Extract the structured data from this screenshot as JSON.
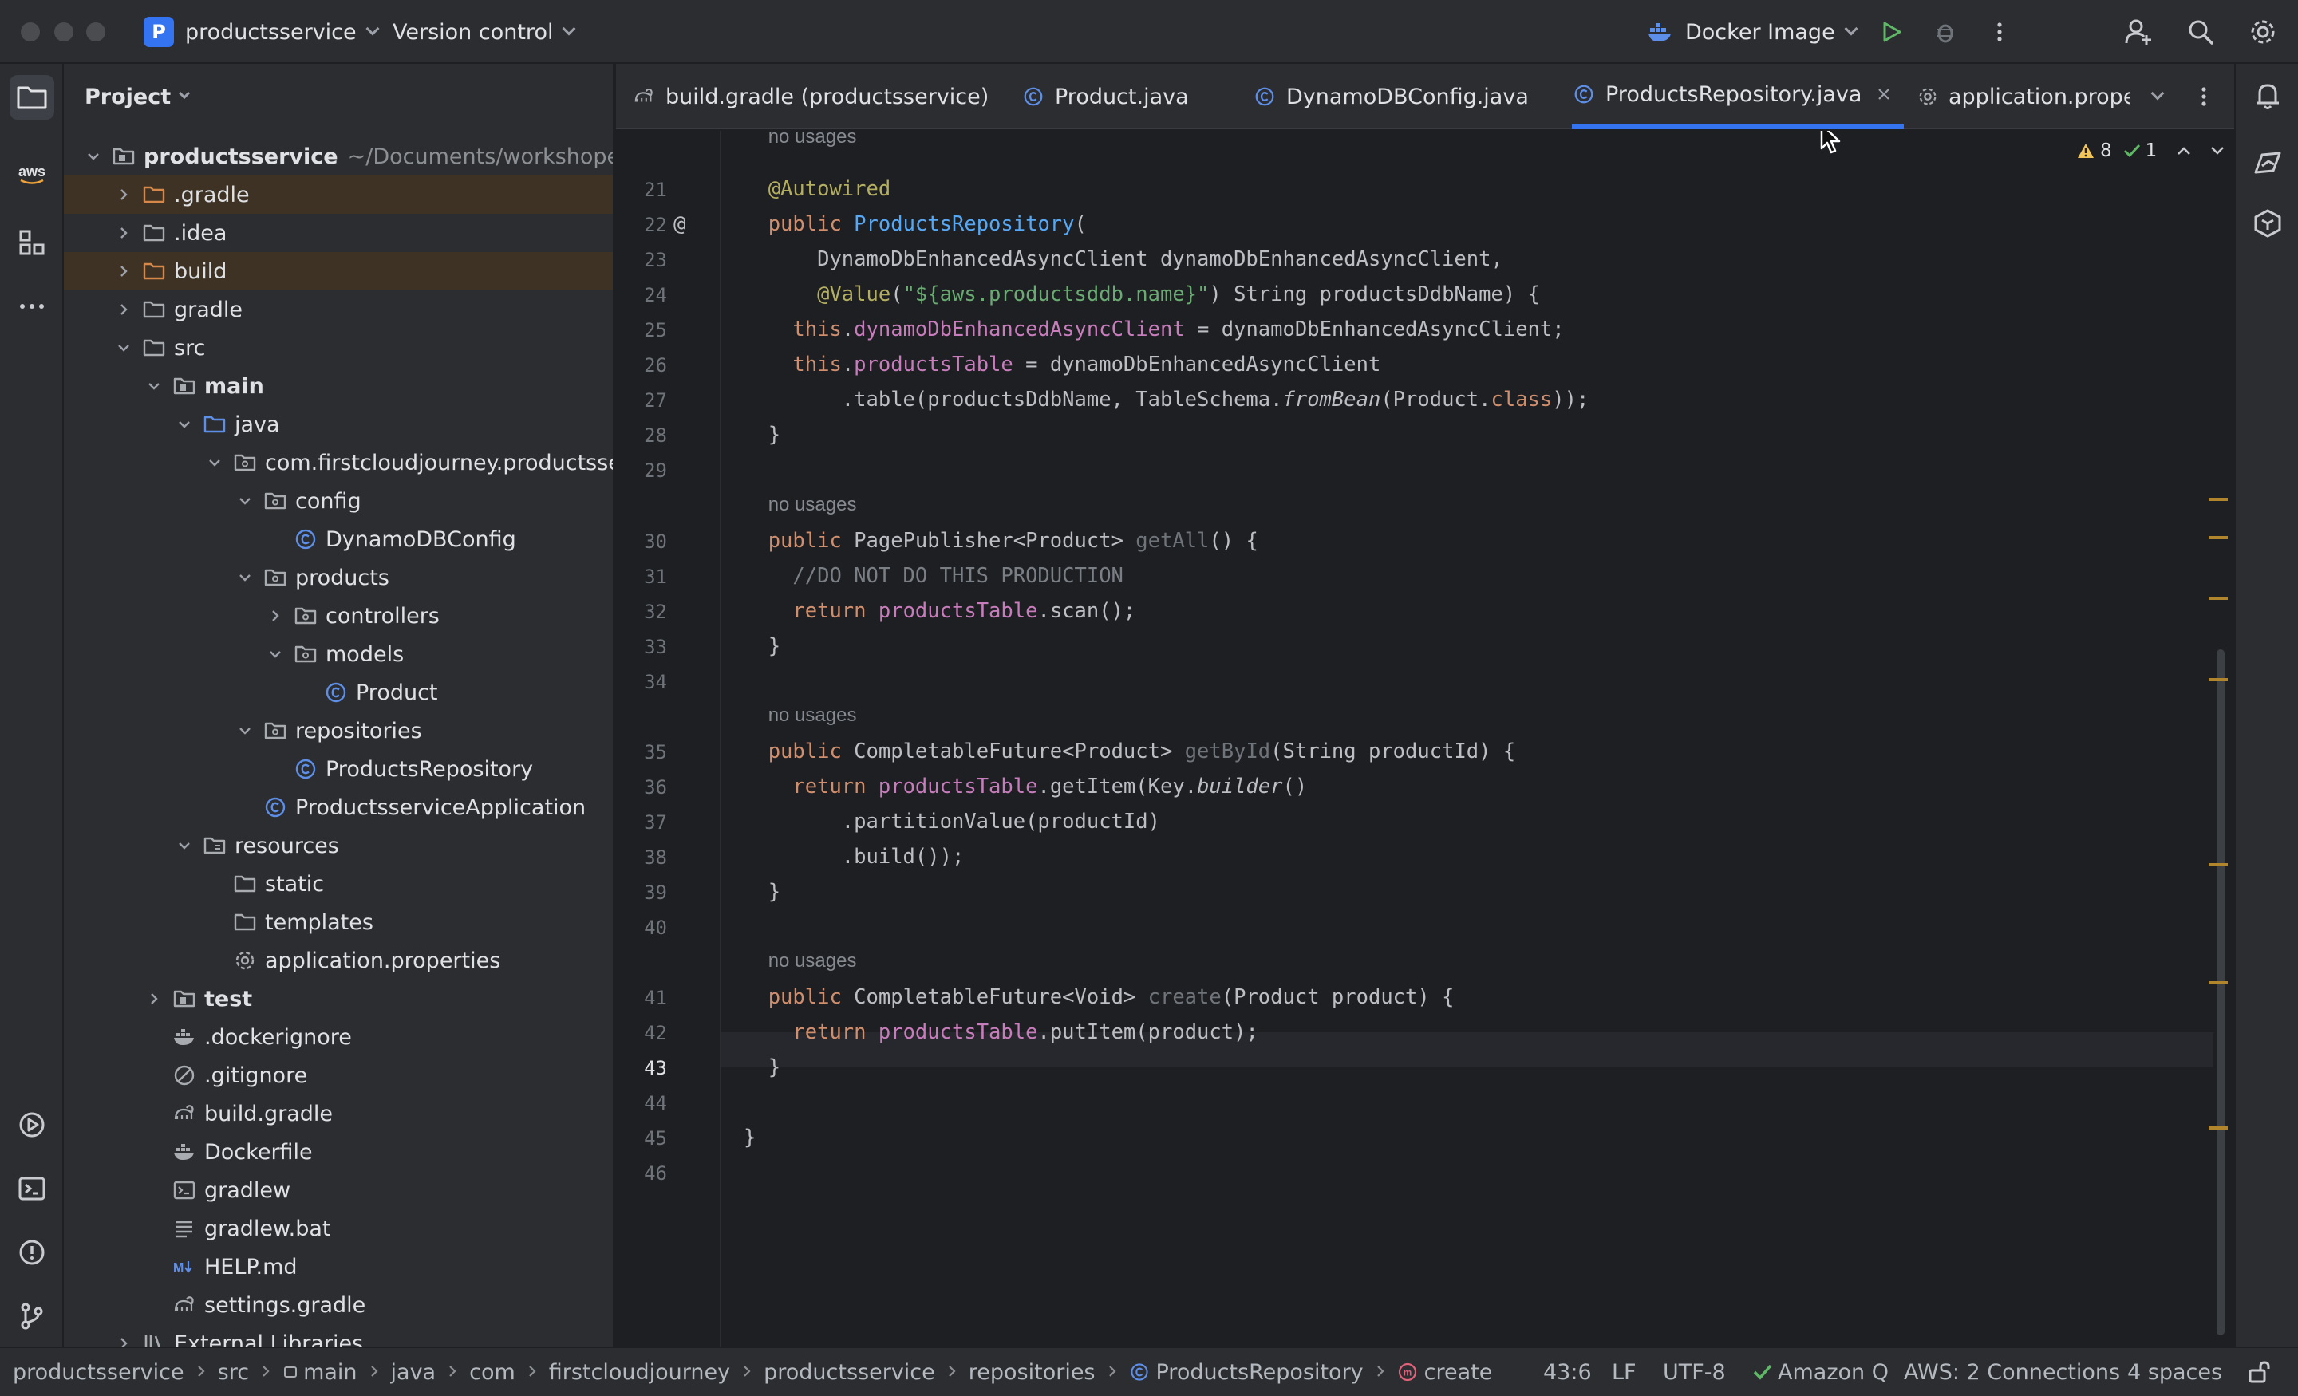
{
  "titlebar": {
    "project_badge": "P",
    "project_name": "productsservice",
    "vcs": "Version control",
    "run_config": "Docker Image"
  },
  "project_panel": {
    "title": "Project",
    "tree": [
      {
        "label": "productsservice",
        "path": "~/Documents/workshope/products",
        "depth": 0,
        "arrow": "open",
        "icon": "module-folder-icon",
        "bold": true
      },
      {
        "label": ".gradle",
        "depth": 1,
        "arrow": "closed",
        "icon": "folder-excluded-icon",
        "excluded": true
      },
      {
        "label": ".idea",
        "depth": 1,
        "arrow": "closed",
        "icon": "folder-icon"
      },
      {
        "label": "build",
        "depth": 1,
        "arrow": "closed",
        "icon": "folder-excluded-icon",
        "excluded": true
      },
      {
        "label": "gradle",
        "depth": 1,
        "arrow": "closed",
        "icon": "folder-icon"
      },
      {
        "label": "src",
        "depth": 1,
        "arrow": "open",
        "icon": "folder-icon"
      },
      {
        "label": "main",
        "depth": 2,
        "arrow": "open",
        "icon": "module-folder-icon",
        "bold": true
      },
      {
        "label": "java",
        "depth": 3,
        "arrow": "open",
        "icon": "source-folder-icon"
      },
      {
        "label": "com.firstcloudjourney.productsservice",
        "depth": 4,
        "arrow": "open",
        "icon": "package-icon"
      },
      {
        "label": "config",
        "depth": 5,
        "arrow": "open",
        "icon": "package-icon"
      },
      {
        "label": "DynamoDBConfig",
        "depth": 6,
        "arrow": "none",
        "icon": "java-class-icon"
      },
      {
        "label": "products",
        "depth": 5,
        "arrow": "open",
        "icon": "package-icon"
      },
      {
        "label": "controllers",
        "depth": 6,
        "arrow": "closed",
        "icon": "package-icon"
      },
      {
        "label": "models",
        "depth": 6,
        "arrow": "open",
        "icon": "package-icon"
      },
      {
        "label": "Product",
        "depth": 7,
        "arrow": "none",
        "icon": "java-class-icon"
      },
      {
        "label": "repositories",
        "depth": 5,
        "arrow": "open",
        "icon": "package-icon"
      },
      {
        "label": "ProductsRepository",
        "depth": 6,
        "arrow": "none",
        "icon": "java-class-icon"
      },
      {
        "label": "ProductsserviceApplication",
        "depth": 5,
        "arrow": "none",
        "icon": "java-class-icon"
      },
      {
        "label": "resources",
        "depth": 3,
        "arrow": "open",
        "icon": "resources-folder-icon"
      },
      {
        "label": "static",
        "depth": 4,
        "arrow": "none",
        "icon": "folder-icon"
      },
      {
        "label": "templates",
        "depth": 4,
        "arrow": "none",
        "icon": "folder-icon"
      },
      {
        "label": "application.properties",
        "depth": 4,
        "arrow": "none",
        "icon": "settings-file-icon"
      },
      {
        "label": "test",
        "depth": 2,
        "arrow": "closed",
        "icon": "module-folder-icon",
        "bold": true
      },
      {
        "label": ".dockerignore",
        "depth": 2,
        "arrow": "none",
        "icon": "docker-icon"
      },
      {
        "label": ".gitignore",
        "depth": 2,
        "arrow": "none",
        "icon": "ignore-file-icon"
      },
      {
        "label": "build.gradle",
        "depth": 2,
        "arrow": "none",
        "icon": "gradle-icon"
      },
      {
        "label": "Dockerfile",
        "depth": 2,
        "arrow": "none",
        "icon": "docker-icon"
      },
      {
        "label": "gradlew",
        "depth": 2,
        "arrow": "none",
        "icon": "terminal-file-icon"
      },
      {
        "label": "gradlew.bat",
        "depth": 2,
        "arrow": "none",
        "icon": "text-file-icon"
      },
      {
        "label": "HELP.md",
        "depth": 2,
        "arrow": "none",
        "icon": "markdown-icon"
      },
      {
        "label": "settings.gradle",
        "depth": 2,
        "arrow": "none",
        "icon": "gradle-icon"
      },
      {
        "label": "External Libraries",
        "depth": 1,
        "arrow": "closed",
        "icon": "library-icon"
      }
    ]
  },
  "tabs": [
    {
      "label": "build.gradle (productsservice)",
      "icon": "gradle-icon"
    },
    {
      "label": "Product.java",
      "icon": "java-class-icon"
    },
    {
      "label": "DynamoDBConfig.java",
      "icon": "java-class-icon"
    },
    {
      "label": "ProductsRepository.java",
      "icon": "java-class-icon",
      "active": true
    },
    {
      "label": "application.proper",
      "icon": "settings-file-icon"
    }
  ],
  "editor": {
    "warnings_count": "8",
    "ok_count": "1",
    "no_usages": "no usages",
    "current_line": "43"
  },
  "statusbar": {
    "breadcrumbs": [
      "productsservice",
      "src",
      "main",
      "java",
      "com",
      "firstcloudjourney",
      "productsservice",
      "repositories",
      "ProductsRepository",
      "create"
    ],
    "position": "43:6",
    "line_sep": "LF",
    "encoding": "UTF-8",
    "amazon_q": "Amazon Q",
    "aws": "AWS: 2 Connections",
    "indent": "4 spaces"
  },
  "colors": {
    "accent": "#3574f0",
    "warning": "#f2c55c",
    "ok": "#5fb865"
  }
}
